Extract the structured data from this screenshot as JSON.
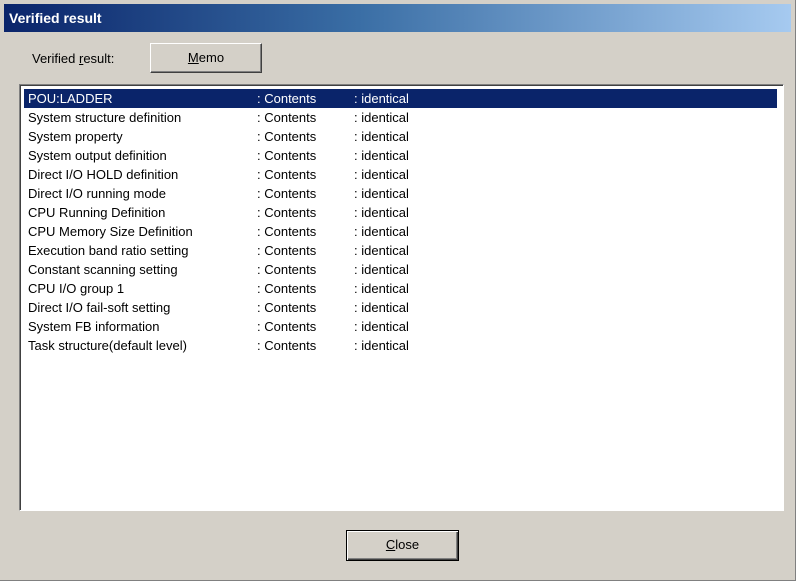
{
  "window": {
    "title": "Verified result"
  },
  "verified_label": {
    "prefix": "Verified ",
    "mnemonic": "r",
    "suffix": "esult:"
  },
  "memo_button": {
    "mnemonic": "M",
    "rest": "emo"
  },
  "close_button": {
    "mnemonic": "C",
    "rest": "lose"
  },
  "results": [
    {
      "item": "POU:LADDER",
      "field": ": Contents",
      "status": ": identical",
      "selected": true
    },
    {
      "item": "System structure definition",
      "field": ": Contents",
      "status": ": identical"
    },
    {
      "item": "System property",
      "field": ": Contents",
      "status": ": identical"
    },
    {
      "item": "System output definition",
      "field": ": Contents",
      "status": ": identical"
    },
    {
      "item": "Direct I/O HOLD definition",
      "field": ": Contents",
      "status": ": identical"
    },
    {
      "item": "Direct I/O running mode",
      "field": ": Contents",
      "status": ": identical"
    },
    {
      "item": "CPU Running Definition",
      "field": ": Contents",
      "status": ": identical"
    },
    {
      "item": "CPU Memory Size Definition",
      "field": ": Contents",
      "status": ": identical"
    },
    {
      "item": "Execution band ratio setting",
      "field": ": Contents",
      "status": ": identical"
    },
    {
      "item": "Constant scanning setting",
      "field": ": Contents",
      "status": ": identical"
    },
    {
      "item": "CPU I/O group 1",
      "field": ": Contents",
      "status": ": identical"
    },
    {
      "item": "Direct I/O fail-soft setting",
      "field": ": Contents",
      "status": ": identical"
    },
    {
      "item": "System FB information",
      "field": ": Contents",
      "status": ": identical"
    },
    {
      "item": "Task structure(default level)",
      "field": ": Contents",
      "status": ": identical"
    }
  ],
  "colors": {
    "title_bar_start": "#0a246a",
    "title_bar_end": "#a6caf0",
    "selection": "#0a246a",
    "dialog_face": "#d4d0c8"
  }
}
